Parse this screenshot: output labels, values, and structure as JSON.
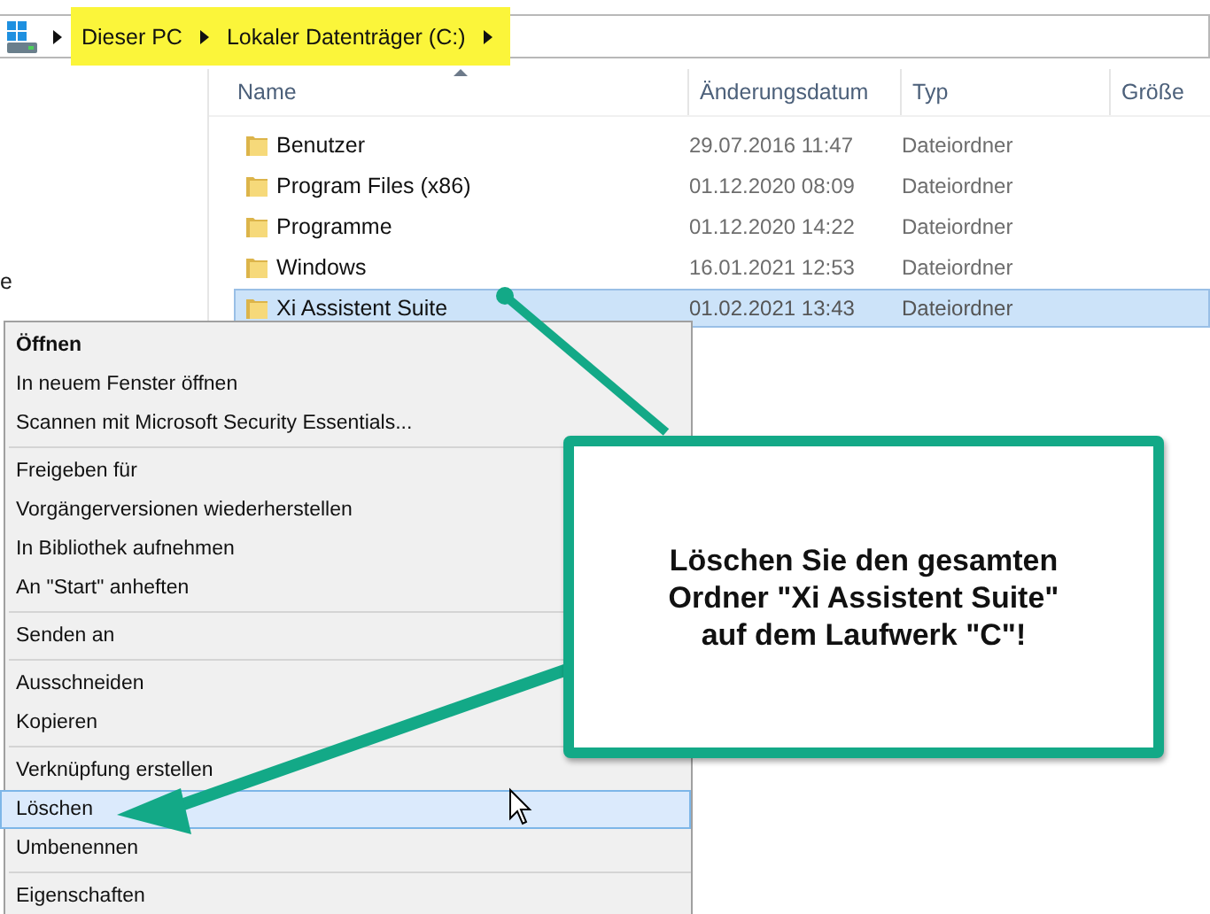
{
  "breadcrumb": {
    "highlighted": true,
    "items": [
      "Dieser PC",
      "Lokaler Datenträger (C:)"
    ]
  },
  "nav_pane": {
    "partial_item": "e"
  },
  "file_list": {
    "columns": [
      "Name",
      "Änderungsdatum",
      "Typ",
      "Größe"
    ],
    "rows": [
      {
        "name": "Benutzer",
        "date": "29.07.2016 11:47",
        "type": "Dateiordner",
        "selected": false
      },
      {
        "name": "Program Files (x86)",
        "date": "01.12.2020 08:09",
        "type": "Dateiordner",
        "selected": false
      },
      {
        "name": "Programme",
        "date": "01.12.2020 14:22",
        "type": "Dateiordner",
        "selected": false
      },
      {
        "name": "Windows",
        "date": "16.01.2021 12:53",
        "type": "Dateiordner",
        "selected": false
      },
      {
        "name": "Xi Assistent Suite",
        "date": "01.02.2021 13:43",
        "type": "Dateiordner",
        "selected": true
      }
    ]
  },
  "context_menu": {
    "groups": [
      [
        {
          "label": "Öffnen",
          "default": true,
          "selected": false
        },
        {
          "label": "In neuem Fenster öffnen",
          "default": false,
          "selected": false
        },
        {
          "label": "Scannen mit Microsoft Security Essentials...",
          "default": false,
          "selected": false
        }
      ],
      [
        {
          "label": "Freigeben für",
          "default": false,
          "selected": false
        },
        {
          "label": "Vorgängerversionen wiederherstellen",
          "default": false,
          "selected": false
        },
        {
          "label": "In Bibliothek aufnehmen",
          "default": false,
          "selected": false
        },
        {
          "label": "An \"Start\" anheften",
          "default": false,
          "selected": false
        }
      ],
      [
        {
          "label": "Senden an",
          "default": false,
          "selected": false
        }
      ],
      [
        {
          "label": "Ausschneiden",
          "default": false,
          "selected": false
        },
        {
          "label": "Kopieren",
          "default": false,
          "selected": false
        }
      ],
      [
        {
          "label": "Verknüpfung erstellen",
          "default": false,
          "selected": false
        },
        {
          "label": "Löschen",
          "default": false,
          "selected": true
        },
        {
          "label": "Umbenennen",
          "default": false,
          "selected": false
        }
      ],
      [
        {
          "label": "Eigenschaften",
          "default": false,
          "selected": false
        }
      ]
    ]
  },
  "callout": {
    "text": "Löschen Sie den gesamten\nOrdner \"Xi Assistent Suite\"\nauf dem Laufwerk \"C\"!"
  }
}
